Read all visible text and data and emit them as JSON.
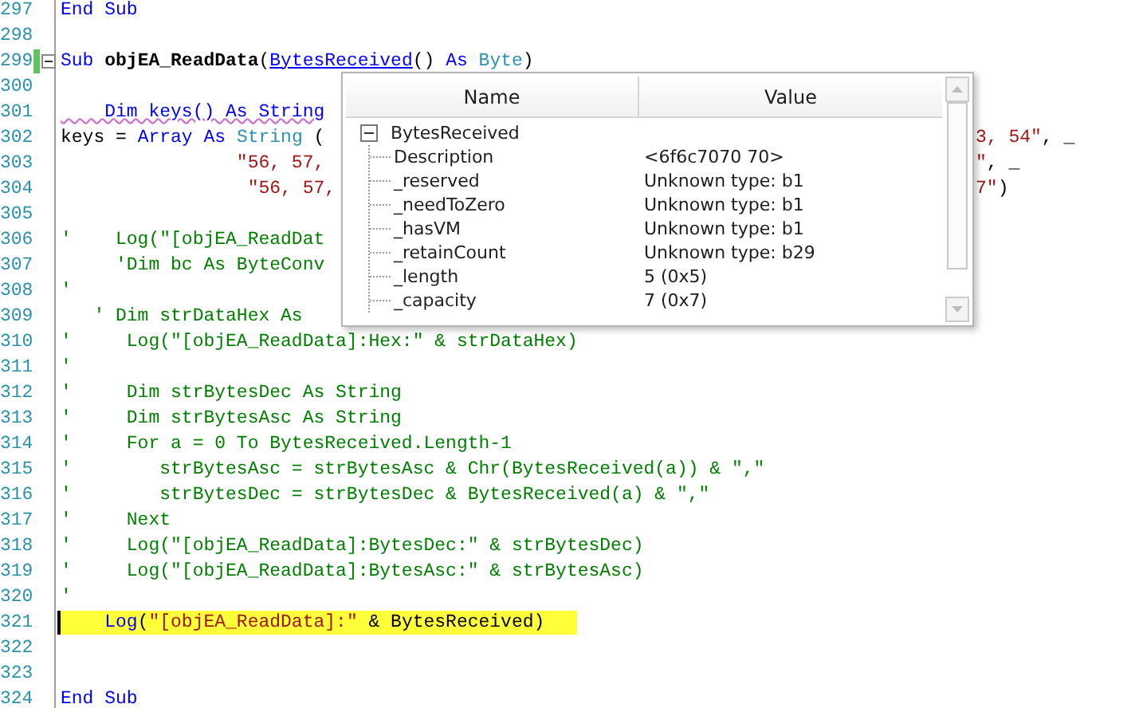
{
  "editor": {
    "lines": [
      {
        "number": "297",
        "modified": false,
        "highlighted": false,
        "segments": [
          {
            "kind": "keyword",
            "text": "End Sub"
          }
        ]
      },
      {
        "number": "298",
        "modified": false
      },
      {
        "number": "299",
        "modified": true,
        "highlighted": false,
        "collapsed": false,
        "segments": [
          {
            "kind": "keyword",
            "text": "Sub "
          },
          {
            "kind": "name",
            "text": "objEA_ReadData"
          },
          {
            "kind": "plain",
            "text": "("
          },
          {
            "kind": "link",
            "text": "BytesReceived"
          },
          {
            "kind": "plain",
            "text": "() "
          },
          {
            "kind": "keyword",
            "text": "As "
          },
          {
            "kind": "type",
            "text": "Byte"
          },
          {
            "kind": "plain",
            "text": ")"
          }
        ]
      },
      {
        "number": "300",
        "modified": false
      },
      {
        "number": "301",
        "modified": false,
        "highlighted": false,
        "segments": [
          {
            "kind": "warning",
            "text": "    Dim keys() As String"
          }
        ]
      },
      {
        "number": "302",
        "modified": false,
        "highlighted": false,
        "segments": [
          {
            "kind": "plain",
            "text": "keys = "
          },
          {
            "kind": "keyword",
            "text": "Array As "
          },
          {
            "kind": "type",
            "text": "String"
          },
          {
            "kind": "plain",
            "text": " ("
          }
        ],
        "tail": [
          {
            "kind": "string",
            "text": "3, 54\""
          },
          {
            "kind": "plain",
            "text": ", _"
          }
        ]
      },
      {
        "number": "303",
        "modified": false,
        "highlighted": false,
        "segments": [
          {
            "kind": "string",
            "text": "                \"56, 57,"
          }
        ],
        "tail": [
          {
            "kind": "string",
            "text": "\""
          },
          {
            "kind": "plain",
            "text": ", _"
          }
        ]
      },
      {
        "number": "304",
        "modified": false,
        "highlighted": false,
        "segments": [
          {
            "kind": "string",
            "text": "                 \"56, 57,"
          }
        ],
        "tail": [
          {
            "kind": "string",
            "text": "7\""
          },
          {
            "kind": "plain",
            "text": ")"
          }
        ]
      },
      {
        "number": "305",
        "modified": false
      },
      {
        "number": "306",
        "modified": false,
        "highlighted": false,
        "segments": [
          {
            "kind": "comment",
            "text": "'    Log(\"[objEA_ReadDat"
          }
        ]
      },
      {
        "number": "307",
        "modified": false,
        "highlighted": false,
        "segments": [
          {
            "kind": "comment",
            "text": "     'Dim bc As ByteConv"
          }
        ]
      },
      {
        "number": "308",
        "modified": false,
        "highlighted": false,
        "segments": [
          {
            "kind": "comment",
            "text": "'"
          }
        ]
      },
      {
        "number": "309",
        "modified": false,
        "highlighted": false,
        "segments": [
          {
            "kind": "comment",
            "text": "   ' Dim strDataHex As"
          }
        ]
      },
      {
        "number": "310",
        "modified": false,
        "highlighted": false,
        "segments": [
          {
            "kind": "comment",
            "text": "'     Log(\"[objEA_ReadData]:Hex:\" & strDataHex)"
          }
        ]
      },
      {
        "number": "311",
        "modified": false,
        "highlighted": false,
        "segments": [
          {
            "kind": "comment",
            "text": "'"
          }
        ]
      },
      {
        "number": "312",
        "modified": false,
        "highlighted": false,
        "segments": [
          {
            "kind": "comment",
            "text": "'     Dim strBytesDec As String"
          }
        ]
      },
      {
        "number": "313",
        "modified": false,
        "highlighted": false,
        "segments": [
          {
            "kind": "comment",
            "text": "'     Dim strBytesAsc As String"
          }
        ]
      },
      {
        "number": "314",
        "modified": false,
        "highlighted": false,
        "segments": [
          {
            "kind": "comment",
            "text": "'     For a = 0 To BytesReceived.Length-1"
          }
        ]
      },
      {
        "number": "315",
        "modified": false,
        "highlighted": false,
        "segments": [
          {
            "kind": "comment",
            "text": "'        strBytesAsc = strBytesAsc & Chr(BytesReceived(a)) & \",\""
          }
        ]
      },
      {
        "number": "316",
        "modified": false,
        "highlighted": false,
        "segments": [
          {
            "kind": "comment",
            "text": "'        strBytesDec = strBytesDec & BytesReceived(a) & \",\""
          }
        ]
      },
      {
        "number": "317",
        "modified": false,
        "highlighted": false,
        "segments": [
          {
            "kind": "comment",
            "text": "'     Next"
          }
        ]
      },
      {
        "number": "318",
        "modified": false,
        "highlighted": false,
        "segments": [
          {
            "kind": "comment",
            "text": "'     Log(\"[objEA_ReadData]:BytesDec:\" & strBytesDec)"
          }
        ]
      },
      {
        "number": "319",
        "modified": false,
        "highlighted": false,
        "segments": [
          {
            "kind": "comment",
            "text": "'     Log(\"[objEA_ReadData]:BytesAsc:\" & strBytesAsc)"
          }
        ]
      },
      {
        "number": "320",
        "modified": false,
        "highlighted": false,
        "segments": [
          {
            "kind": "comment",
            "text": "'"
          }
        ]
      },
      {
        "number": "321",
        "modified": false,
        "highlighted": true,
        "segments": [
          {
            "kind": "keyword",
            "text": "    Log"
          },
          {
            "kind": "plain",
            "text": "("
          },
          {
            "kind": "string",
            "text": "\"[objEA_ReadData]:\""
          },
          {
            "kind": "plain",
            "text": " & BytesReceived)"
          }
        ]
      },
      {
        "number": "322",
        "modified": false
      },
      {
        "number": "323",
        "modified": false
      },
      {
        "number": "324",
        "modified": false,
        "highlighted": false,
        "segments": [
          {
            "kind": "keyword",
            "text": "End Sub"
          }
        ]
      }
    ]
  },
  "watch_popup": {
    "columns": [
      "Name",
      "Value"
    ],
    "items": [
      {
        "name": "BytesReceived",
        "expanded": true,
        "children": [
          {
            "name": "Description",
            "value": "<6f6c7070 70>"
          },
          {
            "name": "_reserved",
            "value": "Unknown type: b1"
          },
          {
            "name": "_needToZero",
            "value": "Unknown type: b1"
          },
          {
            "name": "_hasVM",
            "value": "Unknown type: b1"
          },
          {
            "name": "_retainCount",
            "value": "Unknown type: b29"
          },
          {
            "name": "_length",
            "value": "5 (0x5)"
          },
          {
            "name": "_capacity",
            "value": "7 (0x7)"
          }
        ]
      }
    ]
  }
}
